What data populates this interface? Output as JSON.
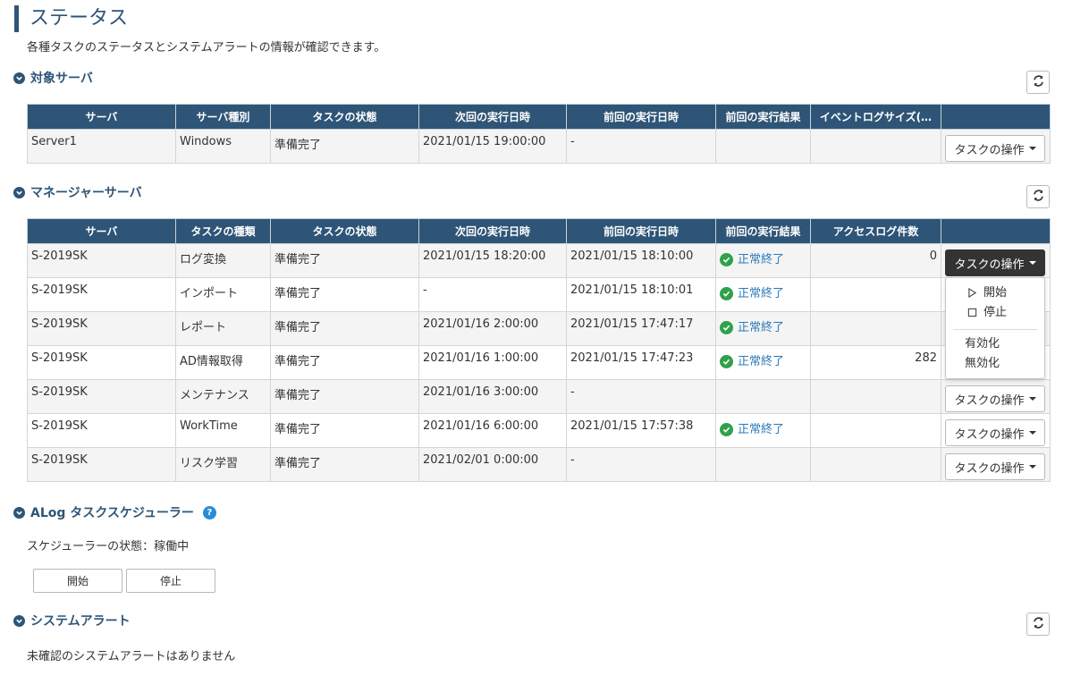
{
  "page": {
    "title": "ステータス",
    "description": "各種タスクのステータスとシステムアラートの情報が確認できます。"
  },
  "colors": {
    "header_bg": "#2e5577",
    "ok_green": "#2fa14a",
    "link_blue": "#2a7ab8"
  },
  "target_servers": {
    "heading": "対象サーバ",
    "columns": [
      "サーバ",
      "サーバ種別",
      "タスクの状態",
      "次回の実行日時",
      "前回の実行日時",
      "前回の実行結果",
      "イベントログサイズ(…",
      ""
    ],
    "rows": [
      {
        "server": "Server1",
        "type": "Windows",
        "state": "準備完了",
        "next": "2021/01/15 19:00:00",
        "prev": "-",
        "result": "",
        "size": "",
        "action": "タスクの操作"
      }
    ]
  },
  "manager_servers": {
    "heading": "マネージャーサーバ",
    "columns": [
      "サーバ",
      "タスクの種類",
      "タスクの状態",
      "次回の実行日時",
      "前回の実行日時",
      "前回の実行結果",
      "アクセスログ件数",
      ""
    ],
    "rows": [
      {
        "server": "S-2019SK",
        "task": "ログ変換",
        "state": "準備完了",
        "next": "2021/01/15 18:20:00",
        "prev": "2021/01/15 18:10:00",
        "result": "正常終了",
        "count": "0",
        "action": "タスクの操作"
      },
      {
        "server": "S-2019SK",
        "task": "インポート",
        "state": "準備完了",
        "next": "-",
        "prev": "2021/01/15 18:10:01",
        "result": "正常終了",
        "count": "",
        "action": ""
      },
      {
        "server": "S-2019SK",
        "task": "レポート",
        "state": "準備完了",
        "next": "2021/01/16 2:00:00",
        "prev": "2021/01/15 17:47:17",
        "result": "正常終了",
        "count": "",
        "action": ""
      },
      {
        "server": "S-2019SK",
        "task": "AD情報取得",
        "state": "準備完了",
        "next": "2021/01/16 1:00:00",
        "prev": "2021/01/15 17:47:23",
        "result": "正常終了",
        "count": "282",
        "action": ""
      },
      {
        "server": "S-2019SK",
        "task": "メンテナンス",
        "state": "準備完了",
        "next": "2021/01/16 3:00:00",
        "prev": "-",
        "result": "",
        "count": "",
        "action": "タスクの操作"
      },
      {
        "server": "S-2019SK",
        "task": "WorkTime",
        "state": "準備完了",
        "next": "2021/01/16 6:00:00",
        "prev": "2021/01/15 17:57:38",
        "result": "正常終了",
        "count": "",
        "action": "タスクの操作"
      },
      {
        "server": "S-2019SK",
        "task": "リスク学習",
        "state": "準備完了",
        "next": "2021/02/01 0:00:00",
        "prev": "-",
        "result": "",
        "count": "",
        "action": "タスクの操作"
      }
    ],
    "dropdown": {
      "start": "開始",
      "stop": "停止",
      "enable": "有効化",
      "disable": "無効化"
    }
  },
  "scheduler": {
    "heading": "ALog タスクスケジューラー",
    "help_icon": "?",
    "state_text": "スケジューラーの状態：稼働中",
    "start_label": "開始",
    "stop_label": "停止"
  },
  "system_alert": {
    "heading": "システムアラート",
    "message": "未確認のシステムアラートはありません"
  }
}
